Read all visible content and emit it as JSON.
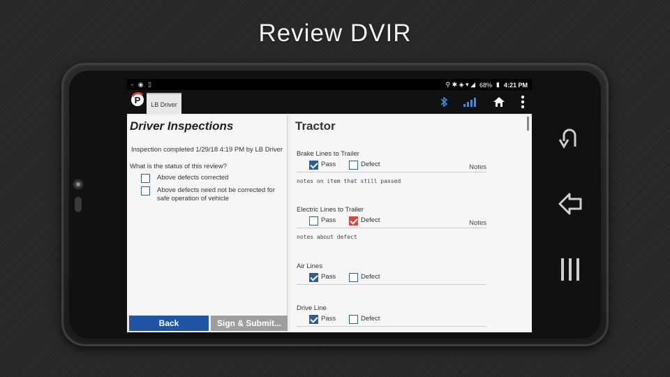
{
  "slide": {
    "title": "Review DVIR"
  },
  "statusbar": {
    "battery": "68%",
    "time": "4:21 PM"
  },
  "appbar": {
    "tab_label": "LB Driver",
    "logo_letter": "P"
  },
  "left_panel": {
    "title": "Driver Inspections",
    "inspection_text": "Inspection completed 1/29/18 4:19 PM by LB Driver",
    "question": "What is the status of this review?",
    "options": [
      {
        "label": "Above defects corrected",
        "checked": false
      },
      {
        "label": "Above defects need not be corrected for safe operation of vehicle",
        "checked": false
      }
    ],
    "back_label": "Back",
    "submit_label": "Sign & Submit..."
  },
  "right_panel": {
    "title": "Tractor",
    "pass_label": "Pass",
    "defect_label": "Defect",
    "notes_label": "Notes",
    "items": [
      {
        "name": "Brake Lines to Trailer",
        "status": "pass",
        "show_notes": true,
        "note": "notes on item that still passed"
      },
      {
        "name": "Electric Lines to Trailer",
        "status": "defect",
        "show_notes": true,
        "note": "notes about defect"
      },
      {
        "name": "Air Lines",
        "status": "pass",
        "show_notes": false,
        "note": ""
      },
      {
        "name": "Drive Line",
        "status": "pass",
        "show_notes": false,
        "note": ""
      }
    ]
  },
  "colors": {
    "primary": "#1f56a3",
    "defect": "#d9453a",
    "checkbox": "#2a5d9c"
  },
  "icons": [
    "bluetooth-icon",
    "signal-icon",
    "home-icon",
    "overflow-menu-icon",
    "back-arrow-icon",
    "return-icon",
    "recent-apps-icon"
  ]
}
